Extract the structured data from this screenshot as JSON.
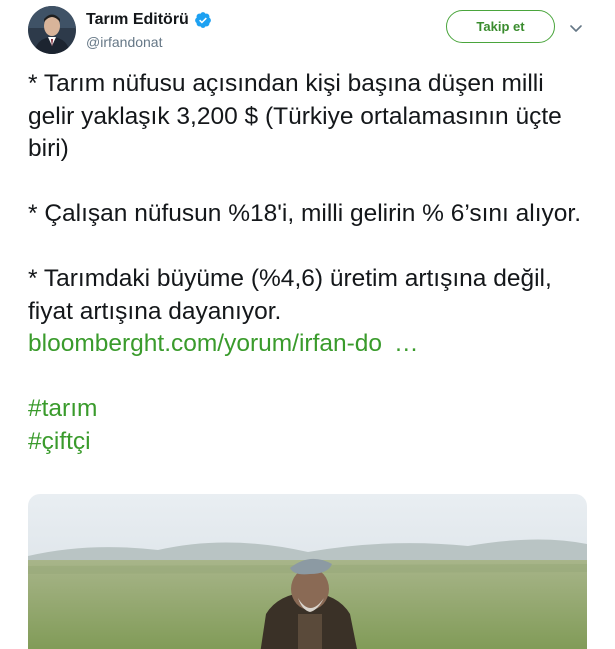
{
  "user": {
    "display_name": "Tarım Editörü",
    "handle": "@irfandonat",
    "verified": true
  },
  "follow_button": {
    "label": "Takip et"
  },
  "tweet": {
    "paragraph1": "* Tarım nüfusu açısından kişi başına düşen milli gelir yaklaşık 3,200 $ (Türkiye ortalamasının üçte biri)",
    "paragraph2": "* Çalışan nüfusun %18'i, milli gelirin % 6’sını alıyor.",
    "paragraph3": "* Tarımdaki büyüme (%4,6) üretim artışına değil, fiyat artışına dayanıyor.",
    "link_text": "bloomberght.com/yorum/irfan-do",
    "link_ellipsis": "…",
    "hashtags": [
      "#tarım",
      "#çiftçi"
    ]
  },
  "colors": {
    "accent": "#3a9b2c",
    "verified_badge": "#1da1f2",
    "text": "#14171a",
    "secondary": "#657786"
  },
  "icons": {
    "verified": "verified-badge-icon",
    "caret": "chevron-down-icon"
  }
}
